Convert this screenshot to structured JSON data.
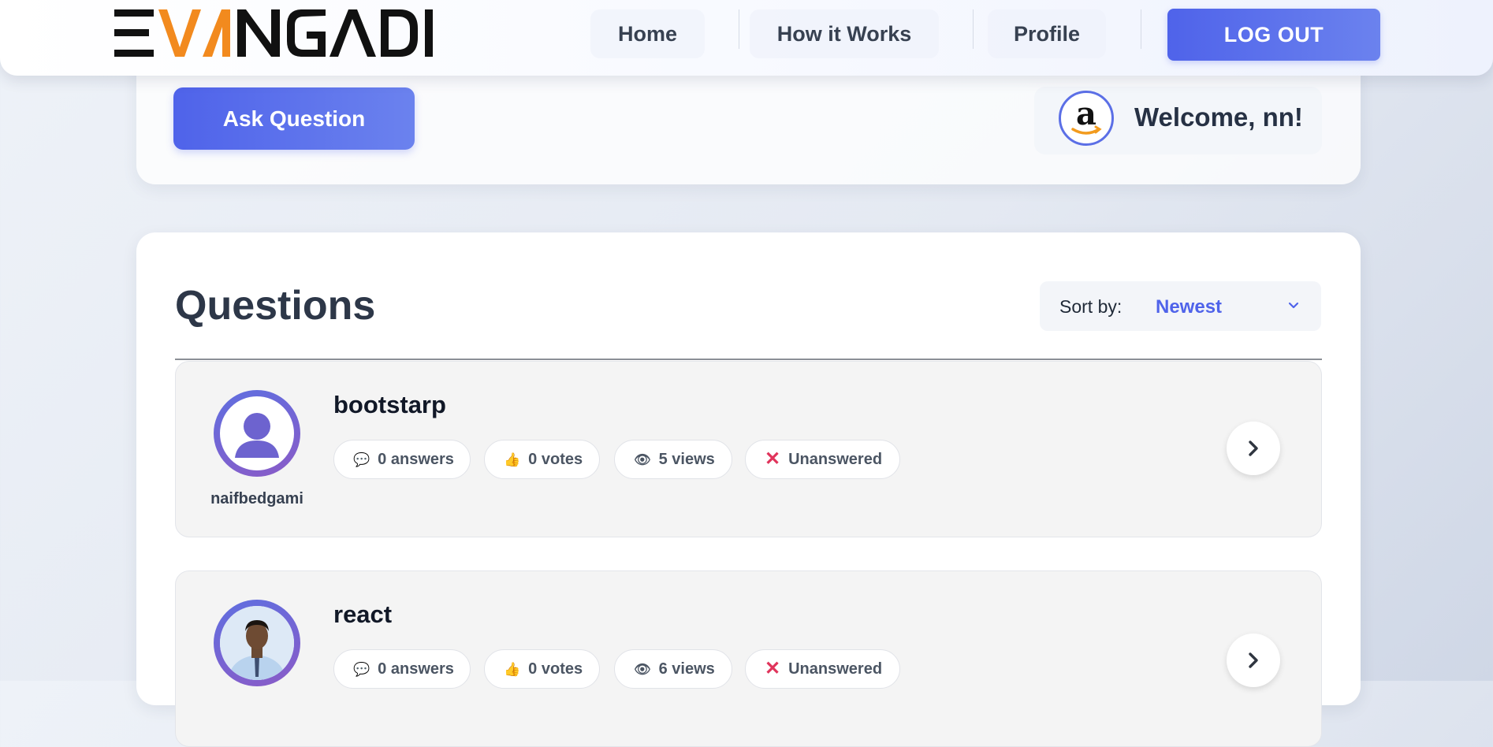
{
  "header": {
    "logo_text": "EVANGADI",
    "nav": [
      {
        "label": "Home"
      },
      {
        "label": "How it Works"
      },
      {
        "label": "Profile"
      }
    ],
    "logout_label": "LOG OUT"
  },
  "top": {
    "ask_button_label": "Ask Question",
    "welcome_text": "Welcome, nn!"
  },
  "questions": {
    "title": "Questions",
    "sort_label": "Sort by:",
    "sort_value": "Newest",
    "items": [
      {
        "title": "bootstarp",
        "username": "naifbedgami",
        "answers": "0 answers",
        "votes": "0 votes",
        "views": "5 views",
        "status": "Unanswered"
      },
      {
        "title": "react",
        "answers": "0 answers",
        "votes": "0 votes",
        "views": "6 views",
        "status": "Unanswered"
      }
    ]
  },
  "colors": {
    "accent": "#4f63ea",
    "logo_orange": "#f28a1e",
    "unanswered": "#e0345b"
  },
  "icons": [
    "speech-bubble-icon",
    "thumbs-up-icon",
    "eye-icon",
    "cross-mark-icon",
    "chevron-right-icon",
    "chevron-down-icon",
    "user-placeholder-icon",
    "amazon-logo-icon"
  ]
}
